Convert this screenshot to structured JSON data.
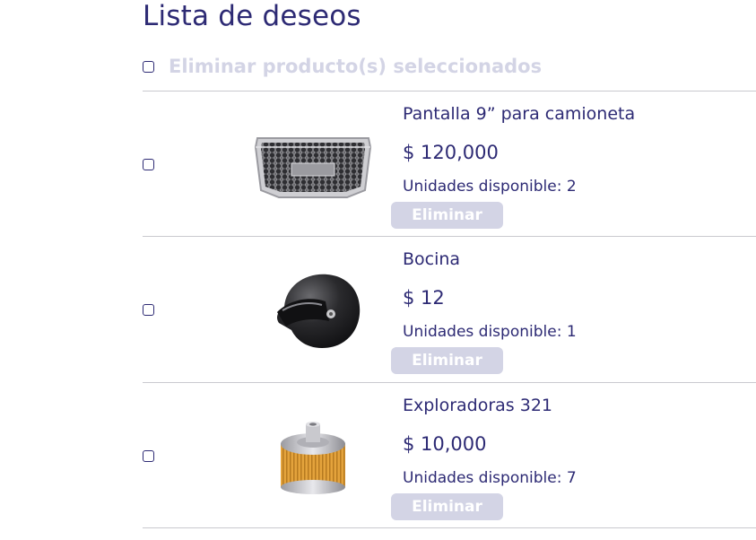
{
  "page": {
    "title": "Lista de deseos"
  },
  "bulk_actions": {
    "delete_selected_label": "Eliminar producto(s) seleccionados",
    "checked": false
  },
  "wishlist": [
    {
      "name": "Pantalla 9” para camioneta",
      "price": "$ 120,000",
      "stock": "Unidades disponible: 2",
      "remove_label": "Eliminar",
      "image": "car-grille-image"
    },
    {
      "name": "Bocina",
      "price": "$ 12",
      "stock": "Unidades disponible: 1",
      "remove_label": "Eliminar",
      "image": "motorcycle-helmet-image"
    },
    {
      "name": "Exploradoras 321",
      "price": "$ 10,000",
      "stock": "Unidades disponible: 7",
      "remove_label": "Eliminar",
      "image": "oil-filter-image"
    }
  ],
  "colors": {
    "primary": "#2d2a74",
    "disabled": "#d3d4e5",
    "divider": "#c9c9cf"
  }
}
